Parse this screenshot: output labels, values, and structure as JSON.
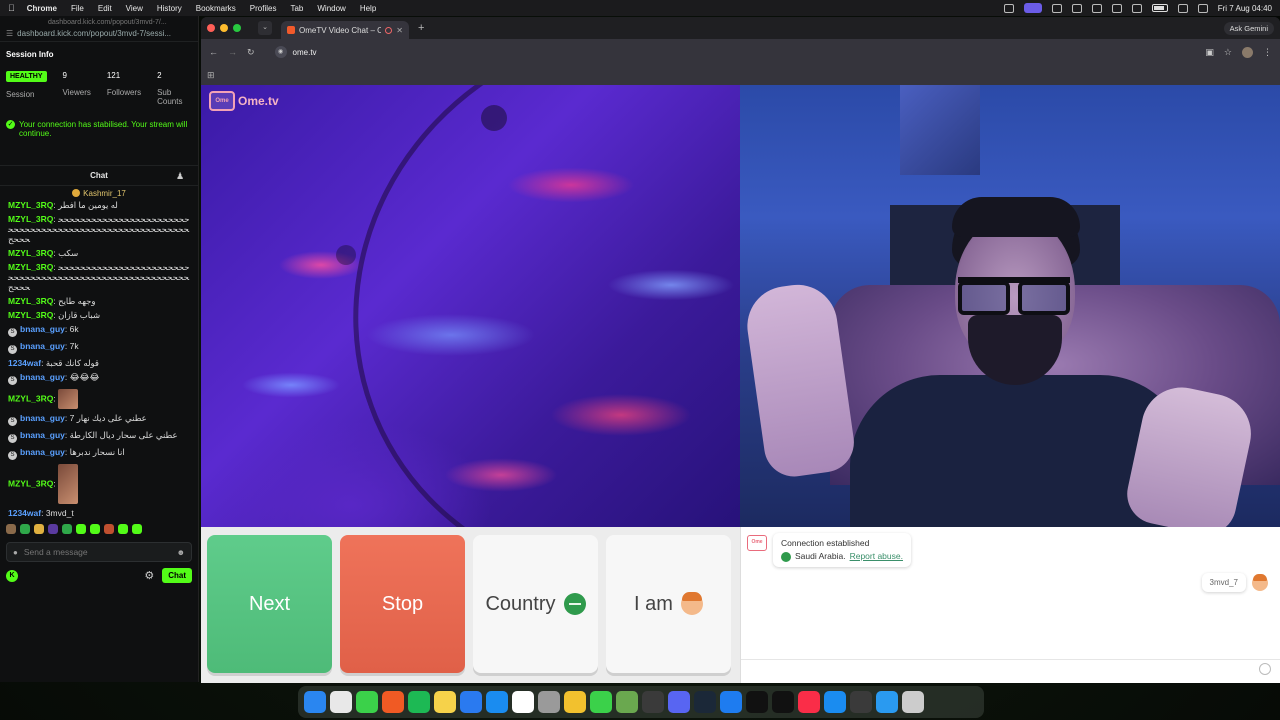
{
  "menubar": {
    "app": "Chrome",
    "items": [
      "File",
      "Edit",
      "View",
      "History",
      "Bookmarks",
      "Profiles",
      "Tab",
      "Window",
      "Help"
    ],
    "clock": "Fri 7 Aug  04:40"
  },
  "kick": {
    "url_top": "dashboard.kick.com/popout/3mvd-7/...",
    "url": "dashboard.kick.com/popout/3mvd-7/sessi...",
    "session_title": "Session Info",
    "session": {
      "badge": "HEALTHY",
      "label": "Session"
    },
    "stats": [
      {
        "num": "9",
        "label": "Viewers"
      },
      {
        "num": "121",
        "label": "Followers"
      },
      {
        "num": "2",
        "label": "Sub Counts"
      }
    ],
    "stabilised": "Your connection has stabilised. Your stream will continue.",
    "chat_title": "Chat",
    "pinned_user": "Kashmir_17",
    "messages": [
      {
        "user": "MZYL_3RQ",
        "color": "green",
        "text": "له يومين ما افطر"
      },
      {
        "user": "MZYL_3RQ",
        "color": "green",
        "text": "ححححححححححححححححححححححححححححححححححححححححححححححححححححححححححححح"
      },
      {
        "user": "MZYL_3RQ",
        "color": "green",
        "text": "سكب"
      },
      {
        "user": "MZYL_3RQ",
        "color": "green",
        "text": "ححححححححححححححححححححححححححححححححححححححححححححححححححححححححححححح"
      },
      {
        "user": "MZYL_3RQ",
        "color": "green",
        "text": "وجهه طايح"
      },
      {
        "user": "MZYL_3RQ",
        "color": "green",
        "text": "شباب قازان"
      },
      {
        "user": "bnana_guy",
        "color": "blue",
        "badge": true,
        "text": "6k"
      },
      {
        "user": "bnana_guy",
        "color": "blue",
        "badge": true,
        "text": "7k"
      },
      {
        "user": "1234waf",
        "color": "blue",
        "text": "قوله كانك قحبة"
      },
      {
        "user": "bnana_guy",
        "color": "blue",
        "badge": true,
        "text": "😂😂😂"
      },
      {
        "user": "MZYL_3RQ",
        "color": "green",
        "text": "",
        "emote": true
      },
      {
        "user": "bnana_guy",
        "color": "blue",
        "badge": true,
        "text": "عطني على ديك نهار 7"
      },
      {
        "user": "bnana_guy",
        "color": "blue",
        "badge": true,
        "text": "عطني على سحار ديال الكارطة"
      },
      {
        "user": "bnana_guy",
        "color": "blue",
        "badge": true,
        "text": "انا نسحار ندبرها"
      },
      {
        "user": "MZYL_3RQ",
        "color": "green",
        "text": "",
        "emote": true,
        "tall": true
      },
      {
        "user": "1234waf",
        "color": "blue",
        "text": "3mvd_t"
      }
    ],
    "send_placeholder": "Send a message",
    "chat_button": "Chat"
  },
  "chrome": {
    "tab_title": "OmeTV Video Chat – Ome...",
    "url": "ome.tv",
    "ask_gemini": "Ask Gemini"
  },
  "ometv": {
    "logo_box": "Ome",
    "logo_text": "Ome.tv",
    "buttons": {
      "next": "Next",
      "stop": "Stop",
      "country": "Country",
      "iam": "I am"
    },
    "system_message": {
      "line1": "Connection established",
      "country": "Saudi Arabia.",
      "report": "Report abuse."
    },
    "my_name": "3mvd_7",
    "chat_placeholder": ""
  },
  "colors": {
    "kick_green": "#53fc18",
    "next": "#56c482",
    "stop": "#e8694f"
  },
  "dock": {
    "icons": [
      "finder-icon",
      "launchpad-icon",
      "messages-icon",
      "brave-icon",
      "spotify-icon",
      "notes-icon",
      "freeform-icon",
      "appstore-icon",
      "notion-icon",
      "settings-icon",
      "chrome-icon",
      "facetime-icon",
      "minecraft-icon",
      "obs-icon",
      "discord-icon",
      "steam-icon",
      "xcode-icon",
      "tiktok-icon",
      "capcut-icon",
      "music-icon",
      "safari-icon",
      "davinci-icon",
      "compass-icon",
      "trash-icon"
    ]
  }
}
